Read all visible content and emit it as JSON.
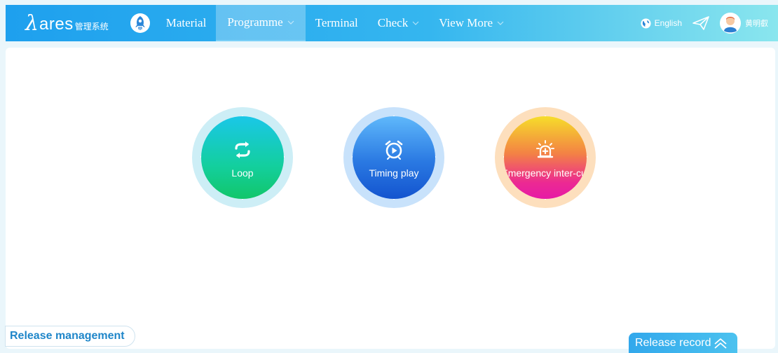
{
  "header": {
    "logo_mark": "λ",
    "logo_word": "ares",
    "logo_subtitle": "管理系统",
    "nav": [
      {
        "label": "Material",
        "has_dropdown": false,
        "active": false
      },
      {
        "label": "Programme",
        "has_dropdown": true,
        "active": true
      },
      {
        "label": "Terminal",
        "has_dropdown": false,
        "active": false
      },
      {
        "label": "Check",
        "has_dropdown": true,
        "active": false
      },
      {
        "label": "View More",
        "has_dropdown": true,
        "active": false
      }
    ],
    "language": "English",
    "user_name": "黄明叡"
  },
  "modes": [
    {
      "label": "Loop",
      "icon": "loop-icon",
      "colors": [
        "#1ac7e8",
        "#12c66a"
      ]
    },
    {
      "label": "Timing play",
      "icon": "alarm-clock-icon",
      "colors": [
        "#5fb8fb",
        "#1354cf"
      ]
    },
    {
      "label": "Emergency inter-cut",
      "icon": "siren-icon",
      "colors": [
        "#f6dd2a",
        "#e61aa6"
      ]
    }
  ],
  "footer": {
    "release_management": "Release management",
    "release_record": "Release record"
  }
}
